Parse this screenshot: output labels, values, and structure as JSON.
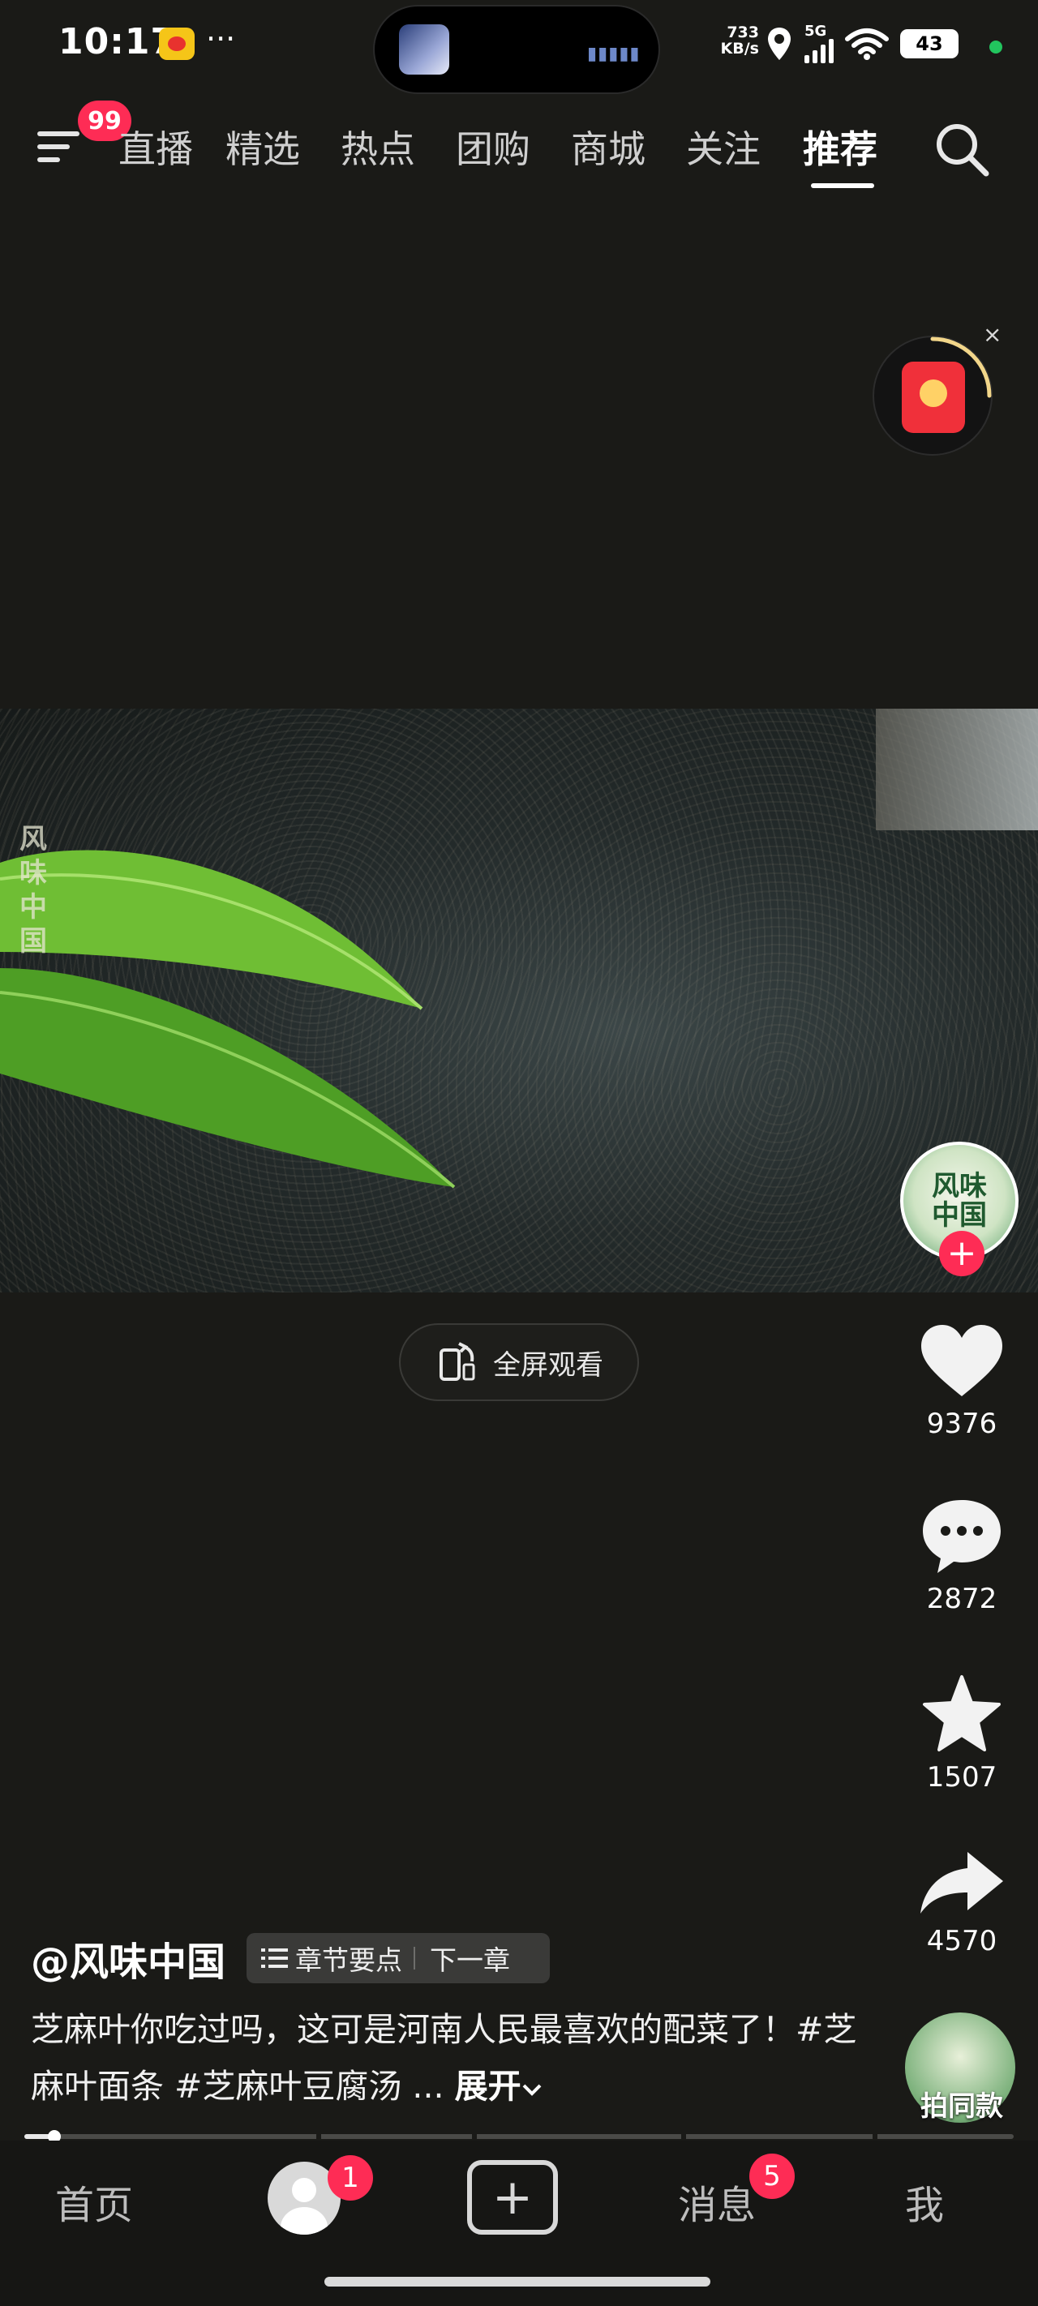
{
  "status_bar": {
    "time": "10:17",
    "net_speed_value": "733",
    "net_speed_unit": "KB/s",
    "network": "5G",
    "battery": "43",
    "more": "···"
  },
  "top_nav": {
    "menu_badge": "99",
    "tabs": [
      "直播",
      "精选",
      "热点",
      "团购",
      "商城",
      "关注",
      "推荐"
    ],
    "active_tab": "推荐"
  },
  "video": {
    "watermark": "风味中国",
    "fullscreen_label": "全屏观看"
  },
  "creator": {
    "avatar_text": "风味中国"
  },
  "actions": {
    "like_count": "9376",
    "comment_count": "2872",
    "favorite_count": "1507",
    "share_count": "4570",
    "same_style_label": "拍同款"
  },
  "caption": {
    "author": "@风味中国",
    "chapter_points": "章节要点",
    "next_chapter": "下一章",
    "text": "芝麻叶你吃过吗，这可是河南人民最喜欢的配菜了！#芝麻叶面条 #芝麻叶豆腐汤 ...",
    "expand": "展开"
  },
  "progress": {
    "played_fraction": 0.03
  },
  "bottom_nav": {
    "home": "首页",
    "friends_badge": "1",
    "messages": "消息",
    "messages_badge": "5",
    "me": "我",
    "create_symbol": "+"
  },
  "colors": {
    "background": "#1a1a17",
    "accent": "#fe2c55",
    "status_dot": "#22c55e"
  }
}
